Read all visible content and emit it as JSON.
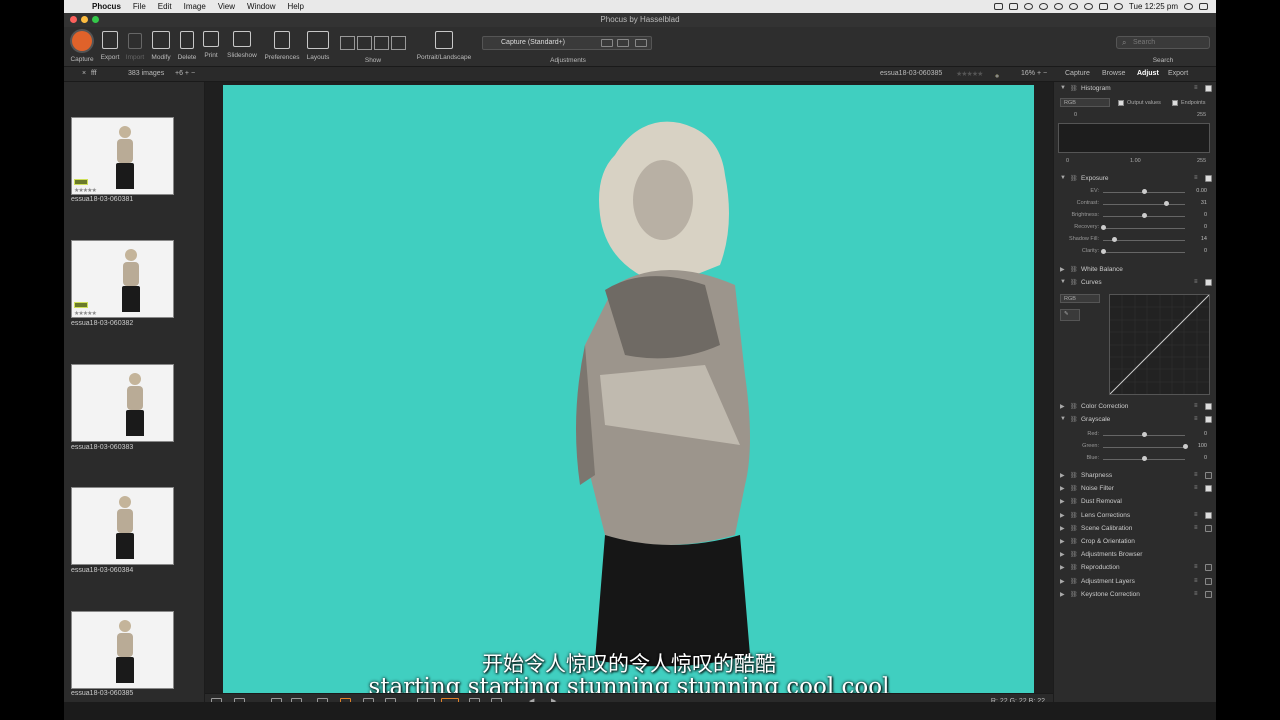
{
  "menubar": {
    "app": "Phocus",
    "items": [
      "File",
      "Edit",
      "Image",
      "View",
      "Window",
      "Help"
    ],
    "clock": "Tue 12:25 pm"
  },
  "window": {
    "title": "Phocus by Hasselblad"
  },
  "toolbar": {
    "capture": "Capture",
    "export": "Export",
    "import": "Import",
    "modify": "Modify",
    "delete": "Delete",
    "print": "Print",
    "slideshow": "Slideshow",
    "preferences": "Preferences",
    "layouts": "Layouts",
    "show": "Show",
    "portrait_landscape": "Portrait/Landscape",
    "preset": "Capture (Standard+)",
    "adjustments": "Adjustments",
    "search_placeholder": "Search",
    "search_label": "Search"
  },
  "tabstrip": {
    "folder": "fff",
    "image_count": "383 images",
    "filename": "essua18-03-060385",
    "zoom": "16%",
    "tabs": [
      "Capture",
      "Browse",
      "Adjust",
      "Export"
    ],
    "active_tab": "Adjust"
  },
  "thumbnails": [
    {
      "label": "essua18-03-060381",
      "rated": true
    },
    {
      "label": "essua18-03-060382",
      "rated": true
    },
    {
      "label": "essua18-03-060383",
      "rated": false
    },
    {
      "label": "essua18-03-060384",
      "rated": false
    },
    {
      "label": "essua18-03-060385",
      "rated": false
    }
  ],
  "viewer": {
    "rgb_readout": "R: 22  G: 22  B: 22",
    "subtitle_cn": "开始令人惊叹的令人惊叹的酷酷",
    "subtitle_en": "starting starting stunning stunning cool cool",
    "background_color": "#40cfc0"
  },
  "panel": {
    "histogram": {
      "title": "Histogram",
      "channel": "RGB",
      "output_values": "Output values",
      "endpoints": "Endpoints",
      "in_low": "0",
      "in_high": "255",
      "out_low": "0",
      "gamma": "1.00",
      "out_high": "255"
    },
    "exposure": {
      "title": "Exposure",
      "sliders": [
        {
          "label": "EV:",
          "value": "0.00",
          "pos": 0.5
        },
        {
          "label": "Contrast:",
          "value": "31",
          "pos": 0.77
        },
        {
          "label": "Brightness:",
          "value": "0",
          "pos": 0.5
        },
        {
          "label": "Recovery:",
          "value": "0",
          "pos": 0.0
        },
        {
          "label": "Shadow Fill:",
          "value": "14",
          "pos": 0.14
        },
        {
          "label": "Clarity:",
          "value": "0",
          "pos": 0.0
        }
      ]
    },
    "white_balance": "White Balance",
    "curves": {
      "title": "Curves",
      "channel": "RGB"
    },
    "color_correction": "Color Correction",
    "grayscale": {
      "title": "Grayscale",
      "sliders": [
        {
          "label": "Red:",
          "value": "0",
          "pos": 0.5
        },
        {
          "label": "Green:",
          "value": "100",
          "pos": 1.0
        },
        {
          "label": "Blue:",
          "value": "0",
          "pos": 0.5
        }
      ]
    },
    "tools": [
      {
        "name": "Sharpness",
        "on": false
      },
      {
        "name": "Noise Filter",
        "on": true
      },
      {
        "name": "Dust Removal",
        "on": null
      },
      {
        "name": "Lens Corrections",
        "on": true
      },
      {
        "name": "Scene Calibration",
        "on": false
      },
      {
        "name": "Crop & Orientation",
        "on": null
      },
      {
        "name": "Adjustments Browser",
        "on": null
      },
      {
        "name": "Reproduction",
        "on": false
      },
      {
        "name": "Adjustment Layers",
        "on": false
      },
      {
        "name": "Keystone Correction",
        "on": false
      }
    ]
  }
}
